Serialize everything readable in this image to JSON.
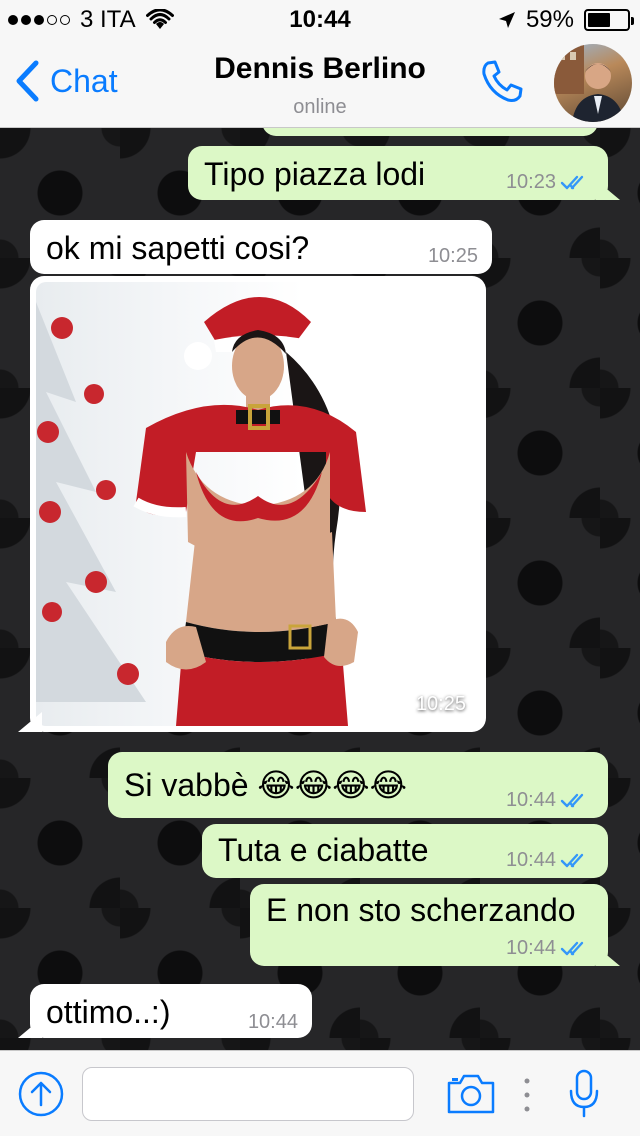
{
  "status_bar": {
    "carrier": "3 ITA",
    "signal_bars_filled": 3,
    "signal_bars_total": 5,
    "time": "10:44",
    "battery_percent": "59%",
    "battery_level": 0.59
  },
  "header": {
    "back_label": "Chat",
    "contact_name": "Dennis Berlino",
    "contact_status": "online"
  },
  "messages": [
    {
      "direction": "outgoing",
      "text": "Tipo piazza lodi",
      "time": "10:23",
      "read": true
    },
    {
      "direction": "incoming",
      "text": "ok mi sapetti cosi?",
      "time": "10:25"
    },
    {
      "direction": "incoming",
      "type": "image",
      "time": "10:25"
    },
    {
      "direction": "outgoing",
      "text": "Si vabbè 😂😂😂😂",
      "time": "10:44",
      "read": true
    },
    {
      "direction": "outgoing",
      "text": "Tuta e ciabatte",
      "time": "10:44",
      "read": true
    },
    {
      "direction": "outgoing",
      "text": "E non sto scherzando",
      "time": "10:44",
      "read": true
    },
    {
      "direction": "incoming",
      "text": "ottimo..:)",
      "time": "10:44"
    }
  ],
  "composer": {
    "placeholder": ""
  },
  "colors": {
    "accent": "#0a7cff",
    "outgoing_bubble": "#dcf8c6",
    "incoming_bubble": "#ffffff",
    "read_ticks": "#3497f9"
  },
  "icons": [
    "wifi-icon",
    "location-arrow-icon",
    "battery-icon",
    "chevron-left-icon",
    "phone-icon",
    "read-receipt-icon",
    "upload-icon",
    "camera-icon",
    "more-icon",
    "microphone-icon"
  ]
}
